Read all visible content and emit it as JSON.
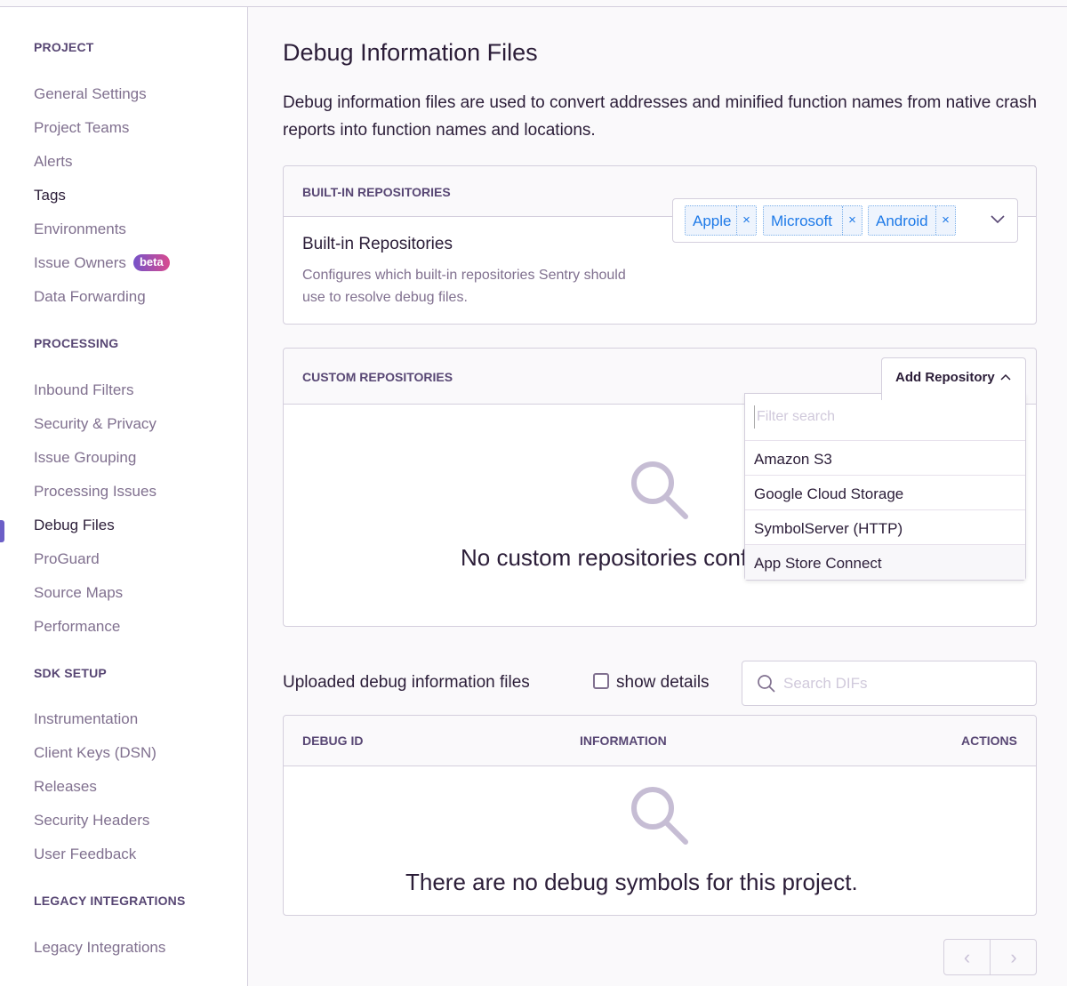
{
  "sidebar": {
    "sections": [
      {
        "title": "PROJECT",
        "items": [
          "General Settings",
          "Project Teams",
          "Alerts",
          "Tags",
          "Environments",
          "Issue Owners",
          "Data Forwarding"
        ]
      },
      {
        "title": "PROCESSING",
        "items": [
          "Inbound Filters",
          "Security & Privacy",
          "Issue Grouping",
          "Processing Issues",
          "Debug Files",
          "ProGuard",
          "Source Maps",
          "Performance"
        ]
      },
      {
        "title": "SDK SETUP",
        "items": [
          "Instrumentation",
          "Client Keys (DSN)",
          "Releases",
          "Security Headers",
          "User Feedback"
        ]
      },
      {
        "title": "LEGACY INTEGRATIONS",
        "items": [
          "Legacy Integrations"
        ]
      }
    ],
    "beta_badge": "beta",
    "active_item": "Debug Files"
  },
  "page": {
    "title": "Debug Information Files",
    "description": "Debug information files are used to convert addresses and minified function names from native crash reports into function names and locations."
  },
  "builtin": {
    "header": "BUILT-IN REPOSITORIES",
    "label": "Built-in Repositories",
    "help": "Configures which built-in repositories Sentry should use to resolve debug files.",
    "tags": [
      "Apple",
      "Microsoft",
      "Android"
    ]
  },
  "custom": {
    "header": "CUSTOM REPOSITORIES",
    "add_button": "Add Repository",
    "empty": "No custom repositories configured",
    "filter_placeholder": "Filter search",
    "options": [
      "Amazon S3",
      "Google Cloud Storage",
      "SymbolServer (HTTP)",
      "App Store Connect"
    ]
  },
  "uploaded": {
    "title": "Uploaded debug information files",
    "show_details": "show details",
    "search_placeholder": "Search DIFs",
    "columns": [
      "DEBUG ID",
      "INFORMATION",
      "ACTIONS"
    ],
    "empty": "There are no debug symbols for this project."
  },
  "icons": {
    "remove": "×",
    "chevron_down": "⌄",
    "chevron_up": "^",
    "prev": "‹",
    "next": "›"
  }
}
